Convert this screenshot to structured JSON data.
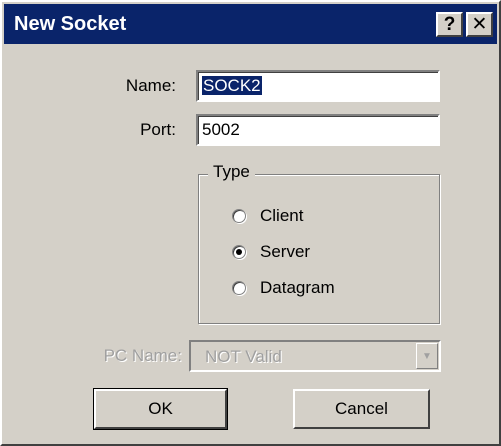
{
  "window": {
    "title": "New Socket",
    "help_glyph": "?",
    "close_glyph": "✕"
  },
  "form": {
    "name_label": "Name:",
    "name_value": "SOCK2",
    "port_label": "Port:",
    "port_value": "5002"
  },
  "type_group": {
    "title": "Type",
    "options": [
      {
        "label": "Client",
        "checked": false
      },
      {
        "label": "Server",
        "checked": true
      },
      {
        "label": "Datagram",
        "checked": false
      }
    ]
  },
  "pc_name": {
    "label": "PC Name:",
    "value": "NOT Valid",
    "enabled": false
  },
  "buttons": {
    "ok": "OK",
    "cancel": "Cancel"
  },
  "colors": {
    "titlebar": "#0a246a",
    "face": "#d4d0c8",
    "selection": "#0a246a"
  },
  "icons": {
    "help": "help-icon",
    "close": "close-icon",
    "combo_arrow": "chevron-down-icon"
  }
}
